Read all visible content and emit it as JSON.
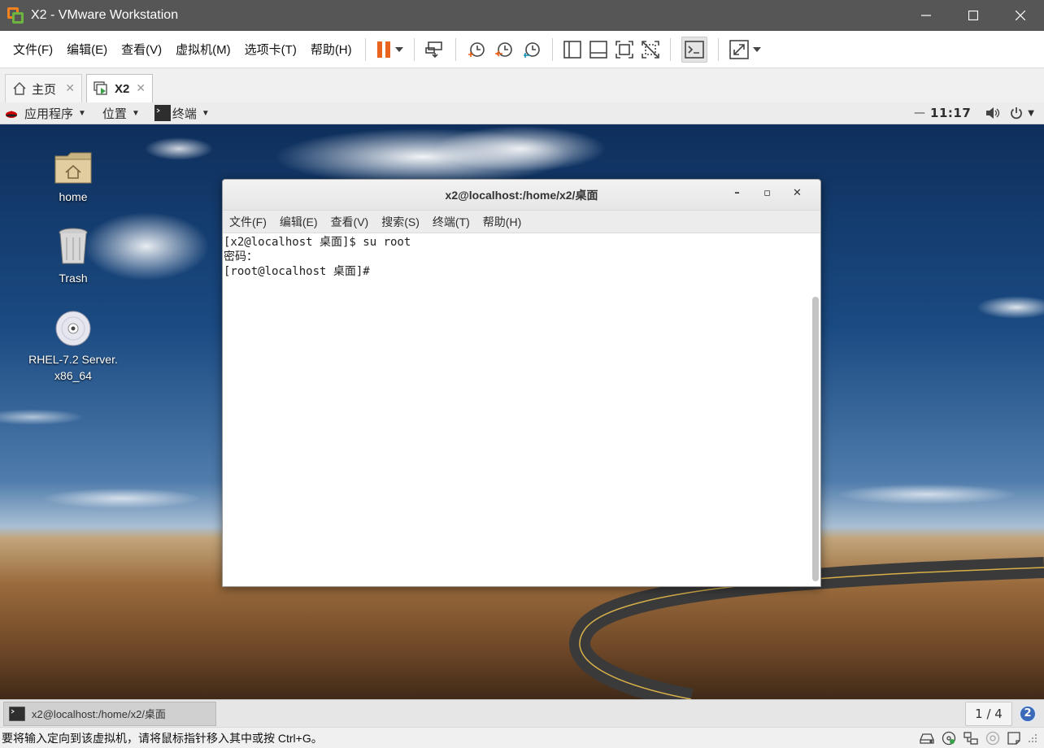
{
  "window": {
    "title": "X2 - VMware Workstation",
    "minimize_icon": "minimize-icon",
    "maximize_icon": "maximize-icon",
    "close_icon": "close-icon"
  },
  "menubar": {
    "items": [
      "文件(F)",
      "编辑(E)",
      "查看(V)",
      "虚拟机(M)",
      "选项卡(T)",
      "帮助(H)"
    ]
  },
  "toolbar": {
    "pause_color": "#e8641e",
    "icons": [
      "pause-icon",
      "send-ctrl-alt-del-icon",
      "snapshot-icon",
      "revert-snapshot-icon",
      "snapshot-manager-icon",
      "library-icon",
      "thumbnail-icon",
      "fullscreen-icon",
      "unity-icon",
      "console-icon",
      "stretch-icon"
    ]
  },
  "tabs": [
    {
      "label": "主页",
      "icon": "home-icon"
    },
    {
      "label": "X2",
      "icon": "vm-running-icon"
    }
  ],
  "guest": {
    "top_panel": {
      "applications": "应用程序",
      "places": "位置",
      "terminal": "终端",
      "clock": "11:17"
    },
    "desktop_icons": [
      {
        "label": "home",
        "icon": "folder-home-icon"
      },
      {
        "label": "Trash",
        "icon": "trash-icon"
      },
      {
        "label_line1": "RHEL-7.2 Server.",
        "label_line2": "x86_64",
        "icon": "dvd-disc-icon"
      }
    ],
    "terminal_window": {
      "title": "x2@localhost:/home/x2/桌面",
      "menu": [
        "文件(F)",
        "编辑(E)",
        "查看(V)",
        "搜索(S)",
        "终端(T)",
        "帮助(H)"
      ],
      "lines": [
        "[x2@localhost 桌面]$ su root",
        "密码：",
        "[root@localhost 桌面]# "
      ]
    },
    "taskbar": {
      "window_button": "x2@localhost:/home/x2/桌面",
      "workspace": "1 / 4",
      "notifications": "2"
    }
  },
  "statusbar": {
    "text": "要将输入定向到该虚拟机，请将鼠标指针移入其中或按 Ctrl+G。"
  }
}
